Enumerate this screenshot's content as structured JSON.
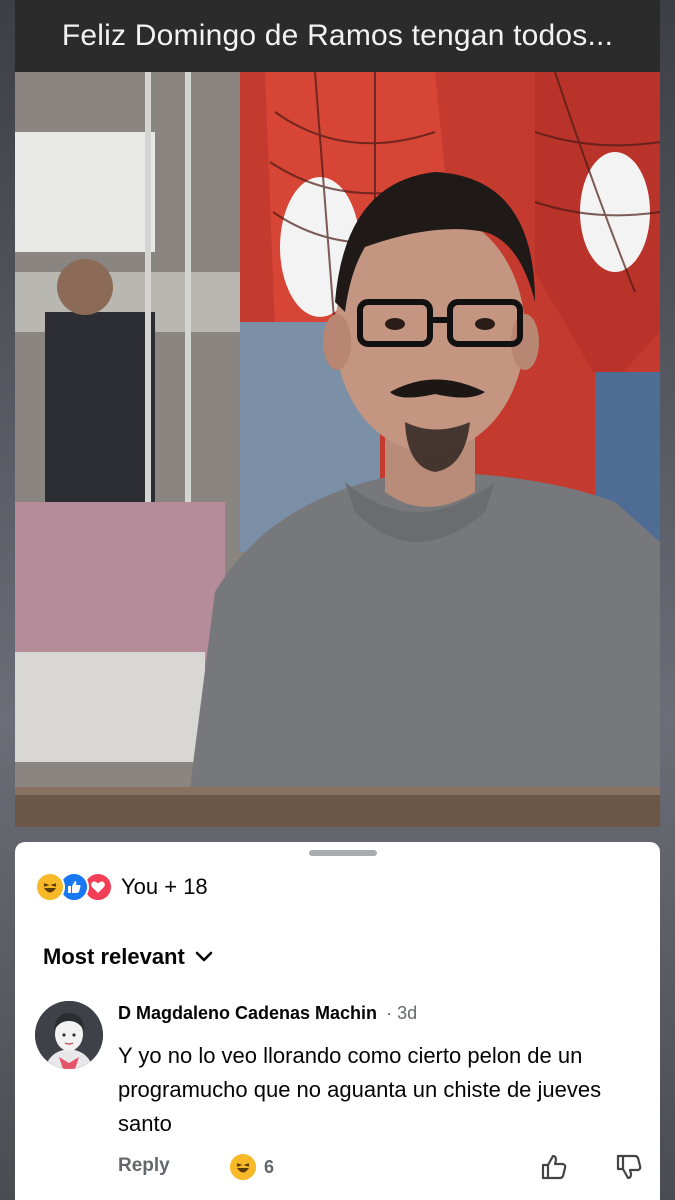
{
  "post": {
    "caption": "Feliz Domingo de Ramos tengan todos..."
  },
  "reactions": {
    "icons": [
      "haha-icon",
      "like-icon",
      "love-icon"
    ],
    "summary": "You + 18"
  },
  "sort": {
    "label": "Most relevant"
  },
  "comment": {
    "author": "D Magdaleno Cadenas Machin",
    "time": "· 3d",
    "text": "Y yo no lo veo llorando como cierto pelon de un programucho que no aguanta un chiste de jueves santo",
    "reply_label": "Reply",
    "reaction_count": "6"
  },
  "colors": {
    "haha": "#f7b928",
    "like": "#1877f2",
    "love": "#f33e58",
    "secondary_text": "#65676b"
  }
}
